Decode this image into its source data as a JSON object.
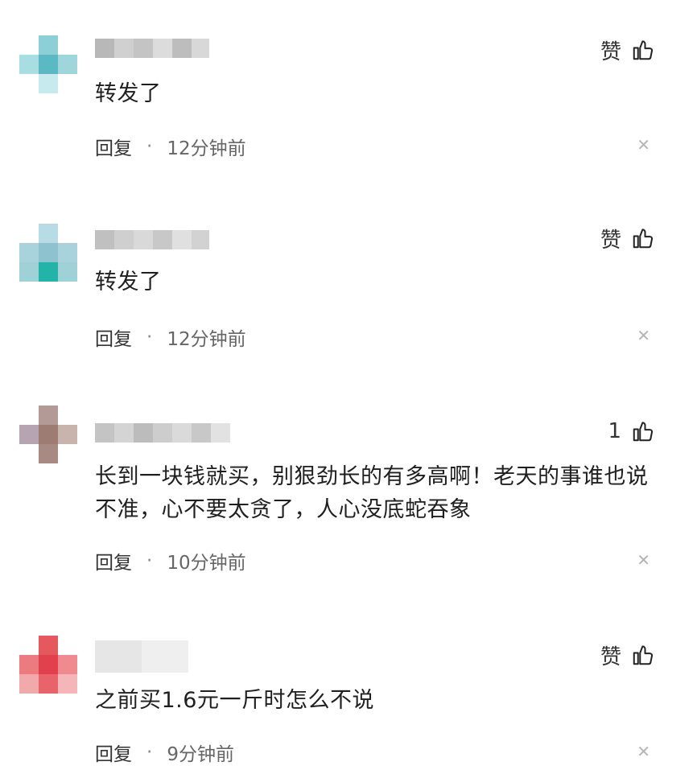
{
  "comments": [
    {
      "text": "转发了",
      "like_label": "赞",
      "reply": "回复",
      "sep": "·",
      "time": "12分钟前"
    },
    {
      "text": "转发了",
      "like_label": "赞",
      "reply": "回复",
      "sep": "·",
      "time": "12分钟前"
    },
    {
      "text": "长到一块钱就买，别狠劲长的有多高啊！老天的事谁也说不准，心不要太贪了，人心没底蛇吞象",
      "like_label": "1",
      "reply": "回复",
      "sep": "·",
      "time": "10分钟前"
    },
    {
      "text": "之前买1.6元一斤时怎么不说",
      "like_label": "赞",
      "reply": "回复",
      "sep": "·",
      "time": "9分钟前"
    }
  ],
  "icons": {
    "like": "thumbs-up-icon",
    "close": "close-icon"
  },
  "colors": {
    "teal": "#5fc3c6",
    "red": "#e0414c",
    "mauve": "#a0807a"
  }
}
